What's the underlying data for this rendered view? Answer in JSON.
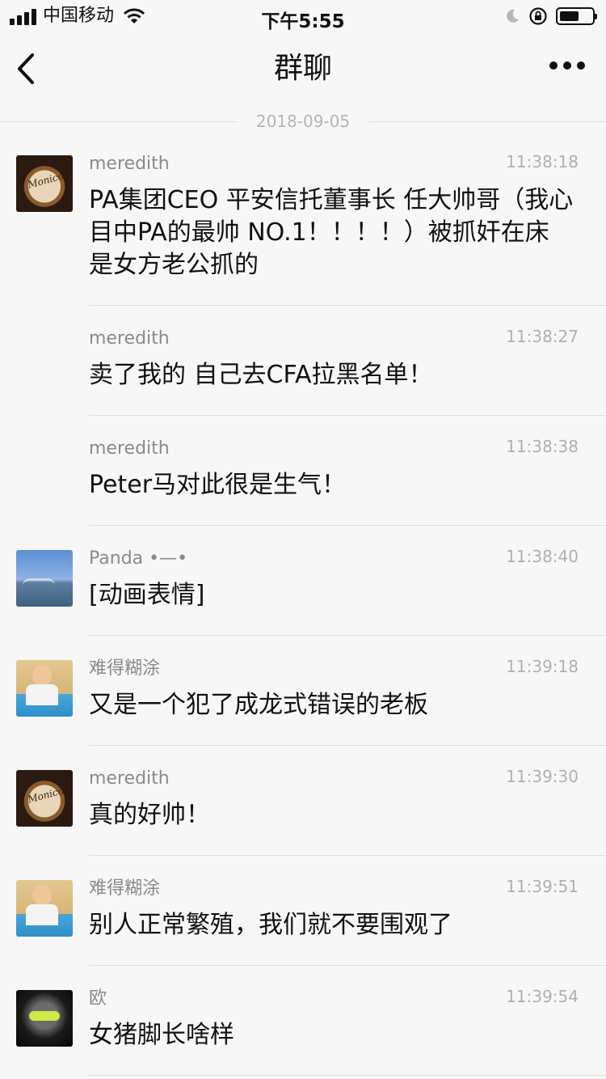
{
  "status_bar": {
    "carrier": "中国移动",
    "time": "下午5:55",
    "battery_level": 0.6
  },
  "nav": {
    "title": "群聊"
  },
  "date_divider": "2018-09-05",
  "messages": [
    {
      "sender": "meredith",
      "time": "11:38:18",
      "text": "PA集团CEO 平安信托董事长 任大帅哥（我心目中PA的最帅 NO.1！！！！）被抓奸在床 是女方老公抓的",
      "avatar": "coffee-avatar"
    },
    {
      "sender": "meredith",
      "time": "11:38:27",
      "text": "卖了我的 自己去CFA拉黑名单！"
    },
    {
      "sender": "meredith",
      "time": "11:38:38",
      "text": "Peter马对此很是生气！"
    },
    {
      "sender": "Panda •—•",
      "time": "11:38:40",
      "text": "[动画表情]",
      "avatar": "harbour-avatar"
    },
    {
      "sender": "难得糊涂",
      "time": "11:39:18",
      "text": "又是一个犯了成龙式错误的老板",
      "avatar": "child-avatar"
    },
    {
      "sender": "meredith",
      "time": "11:39:30",
      "text": "真的好帅！",
      "avatar": "coffee-avatar"
    },
    {
      "sender": "难得糊涂",
      "time": "11:39:51",
      "text": "别人正常繁殖，我们就不要围观了",
      "avatar": "child-avatar"
    },
    {
      "sender": "欧",
      "time": "11:39:54",
      "text": "女猪脚长啥样",
      "avatar": "hooded-avatar"
    }
  ],
  "icons": {
    "back": "chevron-left-icon",
    "more": "more-dots-icon",
    "wifi": "wifi-icon",
    "moon": "moon-icon",
    "rotation_lock": "rotation-lock-icon",
    "battery": "battery-icon"
  }
}
